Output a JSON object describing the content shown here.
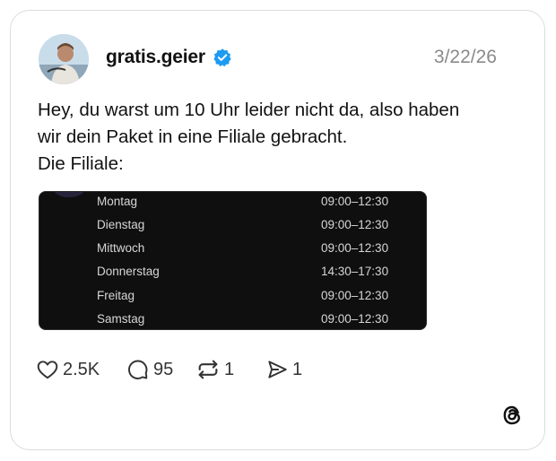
{
  "post": {
    "username": "gratis.geier",
    "date": "3/22/26",
    "text_lines": [
      "Hey, du warst um 10 Uhr leider nicht da, also haben",
      "wir dein Paket in eine Filiale gebracht.",
      "Die Filiale:"
    ]
  },
  "hours": [
    {
      "day": "Montag",
      "time": "09:00–12:30"
    },
    {
      "day": "Dienstag",
      "time": "09:00–12:30"
    },
    {
      "day": "Mittwoch",
      "time": "09:00–12:30"
    },
    {
      "day": "Donnerstag",
      "time": "14:30–17:30"
    },
    {
      "day": "Freitag",
      "time": "09:00–12:30"
    },
    {
      "day": "Samstag",
      "time": "09:00–12:30"
    }
  ],
  "actions": {
    "likes": "2.5K",
    "replies": "95",
    "reposts": "1",
    "shares": "1"
  },
  "icons": [
    "verified-badge-icon",
    "heart-icon",
    "reply-icon",
    "repost-icon",
    "share-icon",
    "threads-logo-icon"
  ],
  "colors": {
    "verified": "#1d9bf0",
    "date": "#8a8a8a",
    "media_bg": "#0f0f10"
  }
}
